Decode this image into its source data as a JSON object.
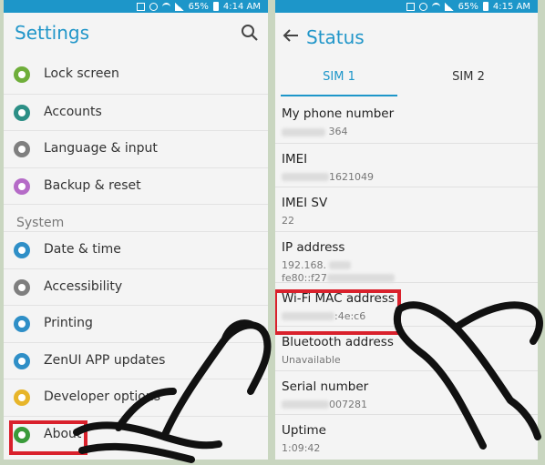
{
  "left": {
    "status": {
      "battery": "65%",
      "time": "4:14 AM"
    },
    "title": "Settings",
    "items_top": [
      {
        "label": "Lock screen",
        "icon": "lock-icon",
        "color": "#6fae3a"
      },
      {
        "label": "Accounts",
        "icon": "person-icon",
        "color": "#2c8f86"
      },
      {
        "label": "Language & input",
        "icon": "language-icon",
        "color": "#7f7f7f"
      },
      {
        "label": "Backup & reset",
        "icon": "backup-icon",
        "color": "#b56bc7"
      }
    ],
    "section": "System",
    "items_system": [
      {
        "label": "Date & time",
        "icon": "clock-icon",
        "color": "#2f8fc7"
      },
      {
        "label": "Accessibility",
        "icon": "hand-icon",
        "color": "#7f7f7f"
      },
      {
        "label": "Printing",
        "icon": "printer-icon",
        "color": "#2f8fc7"
      },
      {
        "label": "ZenUI APP updates",
        "icon": "update-icon",
        "color": "#2f8fc7"
      },
      {
        "label": "Developer options",
        "icon": "brackets-icon",
        "color": "#e7b52a"
      },
      {
        "label": "About",
        "icon": "info-icon",
        "color": "#3a9b3a"
      }
    ]
  },
  "right": {
    "status": {
      "battery": "65%",
      "time": "4:15 AM"
    },
    "title": "Status",
    "tabs": [
      {
        "label": "SIM 1"
      },
      {
        "label": "SIM 2"
      }
    ],
    "rows": [
      {
        "title": "My phone number",
        "value": "364"
      },
      {
        "title": "IMEI",
        "value": "1621049"
      },
      {
        "title": "IMEI SV",
        "value": "22"
      },
      {
        "title": "IP address",
        "value": "192.168.",
        "value2": "fe80::f27"
      },
      {
        "title": "Wi-Fi MAC address",
        "value": ":4e:c6"
      },
      {
        "title": "Bluetooth address",
        "value": "Unavailable"
      },
      {
        "title": "Serial number",
        "value": "007281"
      },
      {
        "title": "Uptime",
        "value": "1:09:42"
      }
    ]
  },
  "colors": {
    "accent": "#1d96c9",
    "highlight": "#d9212c"
  }
}
